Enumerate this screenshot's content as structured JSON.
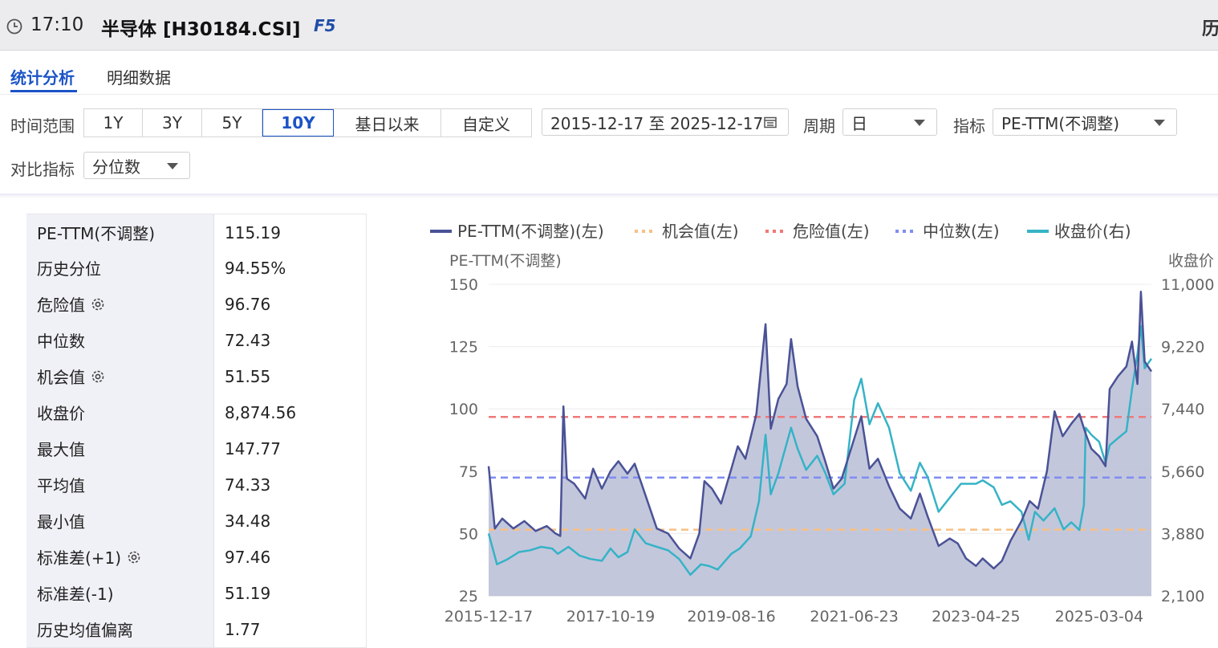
{
  "header": {
    "time": "17:10",
    "title": "半导体 [H30184.CSI]",
    "shortcut": "F5",
    "right_cut": "历"
  },
  "tabs": [
    {
      "label": "统计分析",
      "active": true
    },
    {
      "label": "明细数据",
      "active": false
    }
  ],
  "filters": {
    "time_range_label": "时间范围",
    "ranges": [
      "1Y",
      "3Y",
      "5Y",
      "10Y",
      "基日以来",
      "自定义"
    ],
    "selected_range": "10Y",
    "date_range": "2015-12-17 至 2025-12-17",
    "period_label": "周期",
    "period_value": "日",
    "indicator_label": "指标",
    "indicator_value": "PE-TTM(不调整)",
    "compare_label": "对比指标",
    "compare_value": "分位数"
  },
  "stats": [
    {
      "label": "PE-TTM(不调整)",
      "value": "115.19",
      "gear": false
    },
    {
      "label": "历史分位",
      "value": "94.55%",
      "gear": false
    },
    {
      "label": "危险值",
      "value": "96.76",
      "gear": true
    },
    {
      "label": "中位数",
      "value": "72.43",
      "gear": false
    },
    {
      "label": "机会值",
      "value": "51.55",
      "gear": true
    },
    {
      "label": "收盘价",
      "value": "8,874.56",
      "gear": false
    },
    {
      "label": "最大值",
      "value": "147.77",
      "gear": false
    },
    {
      "label": "平均值",
      "value": "74.33",
      "gear": false
    },
    {
      "label": "最小值",
      "value": "34.48",
      "gear": false
    },
    {
      "label": "标准差(+1)",
      "value": "97.46",
      "gear": true
    },
    {
      "label": "标准差(-1)",
      "value": "51.19",
      "gear": false
    },
    {
      "label": "历史均值偏离",
      "value": "1.77",
      "gear": false
    }
  ],
  "colors": {
    "accent": "#1c54c7",
    "pe_line": "#4a5296",
    "pe_fill": "#b9bdd6",
    "close_line": "#35b3c6",
    "opportunity": "#f7c084",
    "danger": "#f07878",
    "median": "#7f8df2"
  },
  "chart_data": {
    "type": "line",
    "legend": [
      {
        "name": "PE-TTM(不调整)(左)",
        "style": "solid",
        "color": "#4a5296"
      },
      {
        "name": "机会值(左)",
        "style": "dotted",
        "color": "#f7c084"
      },
      {
        "name": "危险值(左)",
        "style": "dotted",
        "color": "#f07878"
      },
      {
        "name": "中位数(左)",
        "style": "dotted",
        "color": "#7f8df2"
      },
      {
        "name": "收盘价(右)",
        "style": "solid",
        "color": "#35b3c6"
      }
    ],
    "legend_position": "top",
    "ylabel_left": "PE-TTM(不调整)",
    "ylabel_right": "收盘价",
    "yticks_left": [
      "150",
      "125",
      "100",
      "75",
      "50",
      "25"
    ],
    "ylim_left": [
      25,
      150
    ],
    "yticks_right": [
      "11,000",
      "9,220",
      "7,440",
      "5,660",
      "3,880",
      "2,100"
    ],
    "ylim_right": [
      2100,
      11000
    ],
    "xticks": [
      "2015-12-17",
      "2017-10-19",
      "2019-08-16",
      "2021-06-23",
      "2023-04-25",
      "2025-03-04"
    ],
    "xlim": [
      "2015-12-17",
      "2025-12-17"
    ],
    "grid": true,
    "ref_lines": {
      "danger": 96.76,
      "median": 72.43,
      "opportunity": 51.55
    },
    "series": [
      {
        "name": "PE-TTM(不调整)(左)",
        "axis": "left",
        "points": [
          [
            "2015-12-17",
            77
          ],
          [
            "2016-01-20",
            52
          ],
          [
            "2016-03-01",
            56
          ],
          [
            "2016-05-01",
            52
          ],
          [
            "2016-07-01",
            55
          ],
          [
            "2016-09-01",
            51
          ],
          [
            "2016-11-01",
            53
          ],
          [
            "2016-12-20",
            50
          ],
          [
            "2017-01-15",
            49
          ],
          [
            "2017-02-01",
            101
          ],
          [
            "2017-02-20",
            72
          ],
          [
            "2017-04-01",
            70
          ],
          [
            "2017-06-01",
            64
          ],
          [
            "2017-07-15",
            76
          ],
          [
            "2017-09-01",
            68
          ],
          [
            "2017-10-19",
            75
          ],
          [
            "2017-12-01",
            79
          ],
          [
            "2018-01-20",
            74
          ],
          [
            "2018-03-01",
            78
          ],
          [
            "2018-05-01",
            65
          ],
          [
            "2018-07-01",
            52
          ],
          [
            "2018-09-01",
            50
          ],
          [
            "2018-11-01",
            44
          ],
          [
            "2019-01-02",
            40
          ],
          [
            "2019-02-20",
            50
          ],
          [
            "2019-03-20",
            71
          ],
          [
            "2019-05-01",
            68
          ],
          [
            "2019-06-20",
            62
          ],
          [
            "2019-08-16",
            76
          ],
          [
            "2019-09-20",
            85
          ],
          [
            "2019-11-01",
            80
          ],
          [
            "2020-01-01",
            98
          ],
          [
            "2020-02-20",
            134
          ],
          [
            "2020-03-20",
            92
          ],
          [
            "2020-05-01",
            104
          ],
          [
            "2020-06-15",
            110
          ],
          [
            "2020-07-10",
            128
          ],
          [
            "2020-08-15",
            109
          ],
          [
            "2020-10-01",
            96
          ],
          [
            "2020-12-01",
            89
          ],
          [
            "2021-01-10",
            80
          ],
          [
            "2021-03-01",
            68
          ],
          [
            "2021-04-15",
            72
          ],
          [
            "2021-06-23",
            88
          ],
          [
            "2021-08-01",
            97
          ],
          [
            "2021-09-15",
            76
          ],
          [
            "2021-11-01",
            80
          ],
          [
            "2022-01-01",
            69
          ],
          [
            "2022-03-01",
            60
          ],
          [
            "2022-05-01",
            56
          ],
          [
            "2022-06-20",
            66
          ],
          [
            "2022-08-01",
            57
          ],
          [
            "2022-10-01",
            45
          ],
          [
            "2022-12-01",
            48
          ],
          [
            "2023-01-15",
            46
          ],
          [
            "2023-03-01",
            40
          ],
          [
            "2023-04-25",
            37
          ],
          [
            "2023-06-01",
            40
          ],
          [
            "2023-08-01",
            36
          ],
          [
            "2023-09-15",
            39
          ],
          [
            "2023-11-01",
            47
          ],
          [
            "2024-01-01",
            55
          ],
          [
            "2024-02-15",
            63
          ],
          [
            "2024-04-01",
            60
          ],
          [
            "2024-05-20",
            75
          ],
          [
            "2024-07-01",
            99
          ],
          [
            "2024-08-15",
            89
          ],
          [
            "2024-10-01",
            94
          ],
          [
            "2024-11-15",
            98
          ],
          [
            "2024-12-20",
            90
          ],
          [
            "2025-01-20",
            84
          ],
          [
            "2025-03-04",
            81
          ],
          [
            "2025-04-08",
            77
          ],
          [
            "2025-05-01",
            108
          ],
          [
            "2025-06-15",
            113
          ],
          [
            "2025-08-01",
            117
          ],
          [
            "2025-09-01",
            127
          ],
          [
            "2025-10-01",
            110
          ],
          [
            "2025-10-20",
            147
          ],
          [
            "2025-11-10",
            119
          ],
          [
            "2025-12-17",
            115
          ]
        ]
      },
      {
        "name": "收盘价(右)",
        "axis": "right",
        "points": [
          [
            "2015-12-17",
            3880
          ],
          [
            "2016-02-01",
            3000
          ],
          [
            "2016-04-01",
            3150
          ],
          [
            "2016-06-01",
            3350
          ],
          [
            "2016-08-01",
            3400
          ],
          [
            "2016-10-01",
            3500
          ],
          [
            "2016-12-01",
            3450
          ],
          [
            "2017-01-01",
            3300
          ],
          [
            "2017-03-01",
            3500
          ],
          [
            "2017-05-01",
            3250
          ],
          [
            "2017-07-01",
            3150
          ],
          [
            "2017-09-01",
            3100
          ],
          [
            "2017-10-19",
            3450
          ],
          [
            "2017-12-01",
            3200
          ],
          [
            "2018-01-20",
            3350
          ],
          [
            "2018-03-01",
            4000
          ],
          [
            "2018-05-01",
            3600
          ],
          [
            "2018-07-01",
            3500
          ],
          [
            "2018-09-01",
            3400
          ],
          [
            "2018-11-01",
            3150
          ],
          [
            "2019-01-02",
            2700
          ],
          [
            "2019-03-01",
            3000
          ],
          [
            "2019-04-15",
            2950
          ],
          [
            "2019-06-01",
            2850
          ],
          [
            "2019-08-16",
            3300
          ],
          [
            "2019-10-01",
            3450
          ],
          [
            "2019-12-01",
            3800
          ],
          [
            "2020-01-15",
            4800
          ],
          [
            "2020-02-20",
            6700
          ],
          [
            "2020-03-20",
            5000
          ],
          [
            "2020-05-01",
            5600
          ],
          [
            "2020-07-10",
            6900
          ],
          [
            "2020-08-15",
            6300
          ],
          [
            "2020-10-01",
            5700
          ],
          [
            "2020-12-01",
            6100
          ],
          [
            "2021-01-15",
            5600
          ],
          [
            "2021-03-01",
            5000
          ],
          [
            "2021-05-01",
            5300
          ],
          [
            "2021-06-23",
            7700
          ],
          [
            "2021-08-01",
            8300
          ],
          [
            "2021-09-15",
            7000
          ],
          [
            "2021-11-01",
            7600
          ],
          [
            "2022-01-01",
            6900
          ],
          [
            "2022-03-01",
            5600
          ],
          [
            "2022-05-01",
            5100
          ],
          [
            "2022-06-20",
            5900
          ],
          [
            "2022-08-01",
            5500
          ],
          [
            "2022-10-01",
            4500
          ],
          [
            "2022-12-01",
            4900
          ],
          [
            "2023-02-01",
            5300
          ],
          [
            "2023-04-25",
            5300
          ],
          [
            "2023-06-01",
            5400
          ],
          [
            "2023-08-01",
            5200
          ],
          [
            "2023-09-15",
            4700
          ],
          [
            "2023-11-01",
            4800
          ],
          [
            "2024-01-01",
            4500
          ],
          [
            "2024-02-10",
            3700
          ],
          [
            "2024-03-15",
            4500
          ],
          [
            "2024-05-01",
            4250
          ],
          [
            "2024-07-01",
            4600
          ],
          [
            "2024-08-20",
            4000
          ],
          [
            "2024-10-01",
            4200
          ],
          [
            "2024-11-15",
            3980
          ],
          [
            "2024-12-10",
            4700
          ],
          [
            "2024-12-20",
            6900
          ],
          [
            "2025-01-20",
            6700
          ],
          [
            "2025-03-04",
            6500
          ],
          [
            "2025-04-08",
            5900
          ],
          [
            "2025-05-01",
            6400
          ],
          [
            "2025-06-15",
            6600
          ],
          [
            "2025-08-01",
            6800
          ],
          [
            "2025-09-01",
            8000
          ],
          [
            "2025-10-01",
            9000
          ],
          [
            "2025-10-20",
            9800
          ],
          [
            "2025-11-10",
            8600
          ],
          [
            "2025-12-17",
            8874
          ]
        ]
      }
    ]
  }
}
